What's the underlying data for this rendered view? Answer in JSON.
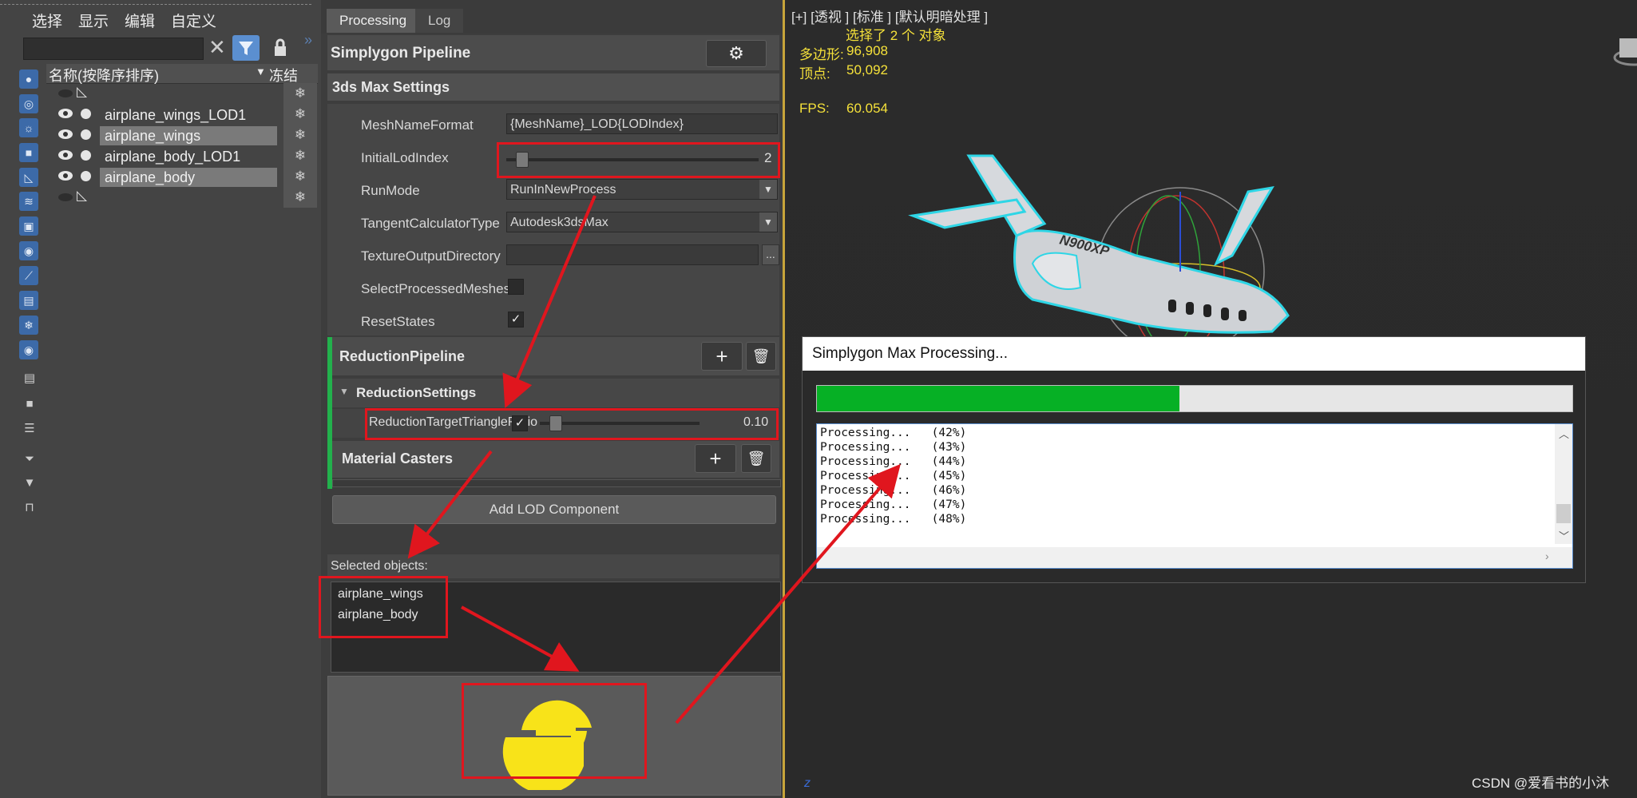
{
  "menu": [
    "选择",
    "显示",
    "编辑",
    "自定义"
  ],
  "scene": {
    "col_name": "名称(按降序排序)",
    "col_freeze": "冻结",
    "rows": [
      {
        "label": ""
      },
      {
        "label": "airplane_wings_LOD1"
      },
      {
        "label": "airplane_wings"
      },
      {
        "label": "airplane_body_LOD1"
      },
      {
        "label": "airplane_body"
      },
      {
        "label": ""
      }
    ],
    "freeze_glyph": "❄"
  },
  "tabs": [
    "Processing",
    "Log"
  ],
  "pipeline": {
    "title": "Simplygon Pipeline",
    "max_settings": "3ds Max Settings",
    "props": [
      {
        "label": "MeshNameFormat",
        "value": "{MeshName}_LOD{LODIndex}"
      },
      {
        "label": "InitialLodIndex",
        "value": "2"
      },
      {
        "label": "RunMode",
        "value": "RunInNewProcess"
      },
      {
        "label": "TangentCalculatorType",
        "value": "Autodesk3dsMax"
      },
      {
        "label": "TextureOutputDirectory",
        "value": ""
      },
      {
        "label": "SelectProcessedMeshes",
        "value": ""
      },
      {
        "label": "ResetStates",
        "value": ""
      }
    ],
    "browse_label": "...",
    "reduction_pipeline": "ReductionPipeline",
    "reduction_settings": "ReductionSettings",
    "ratio_label": "ReductionTargetTriangleRatio",
    "ratio_value": "0.10",
    "material_casters": "Material Casters",
    "add_lod": "Add LOD Component",
    "selected_label": "Selected objects:",
    "selected": [
      "airplane_wings",
      "airplane_body"
    ],
    "plus_glyph": "+",
    "trash_glyph": "🗑"
  },
  "viewport": {
    "label": "[+] [透视 ] [标准 ] [默认明暗处理 ]",
    "selected_info": "选择了 2 个 对象",
    "poly_label": "多边形:",
    "poly_value": "96,908",
    "vert_label": "顶点:",
    "vert_value": "50,092",
    "fps_label": "FPS:",
    "fps_value": "60.054",
    "plane_reg": "N900XP",
    "watermark": "CSDN @爱看书的小沐"
  },
  "dialog": {
    "title": "Simplygon Max Processing...",
    "progress": 0.48,
    "log": [
      "Processing...   (42%)",
      "Processing...   (43%)",
      "Processing...   (44%)",
      "Processing...   (45%)",
      "Processing...   (46%)",
      "Processing...   (47%)",
      "Processing...   (48%)"
    ]
  },
  "colors": {
    "accent_green": "#22b14c",
    "progress_green": "#06b025",
    "annotation_red": "#e0161e",
    "logo_yellow": "#f8e319",
    "tool_blue": "#3c6aa8"
  }
}
